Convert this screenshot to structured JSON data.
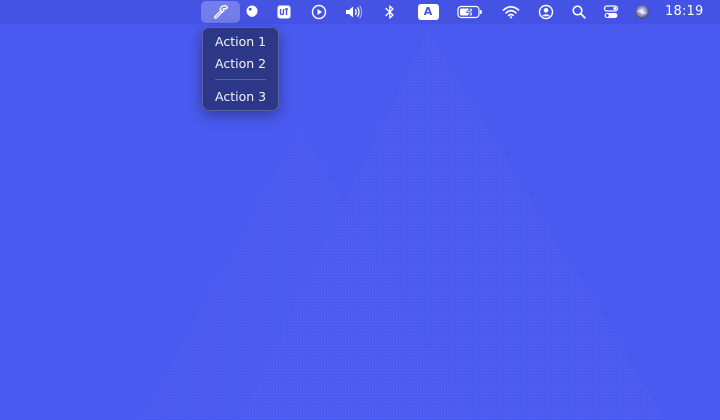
{
  "menubar": {
    "clock": "18:19",
    "status_items": [
      {
        "icon": "hammer-icon",
        "active": true
      },
      {
        "icon": "balloon-icon"
      },
      {
        "icon": "ui-app-icon"
      },
      {
        "icon": "play-circle-icon"
      },
      {
        "icon": "volume-icon"
      },
      {
        "icon": "bluetooth-icon"
      },
      {
        "icon": "input-source-icon",
        "text": "A"
      },
      {
        "icon": "battery-charging-icon"
      },
      {
        "icon": "wifi-icon"
      },
      {
        "icon": "user-account-icon"
      },
      {
        "icon": "spotlight-search-icon"
      },
      {
        "icon": "control-center-icon"
      },
      {
        "icon": "siri-icon"
      }
    ]
  },
  "dropdown": {
    "items": [
      {
        "label": "Action 1"
      },
      {
        "label": "Action 2"
      },
      {
        "label": "Action 3"
      }
    ]
  },
  "colors": {
    "desktop": "#4a5af0",
    "menubar": "#4453e3",
    "dropdown": "#2d3787"
  }
}
